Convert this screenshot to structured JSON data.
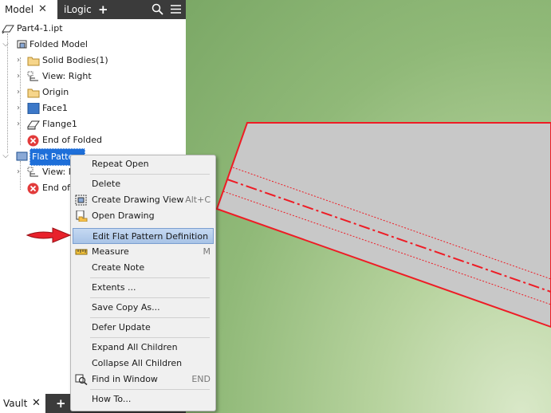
{
  "browser": {
    "tabs": [
      {
        "label": "Model",
        "close": "✕"
      },
      {
        "label": "iLogic"
      }
    ],
    "add_tab": "+",
    "tree": {
      "root": "Part4-1.ipt",
      "folded_model": "Folded Model",
      "solid_bodies": "Solid Bodies(1)",
      "view_right": "View: Right",
      "origin": "Origin",
      "face1": "Face1",
      "flange1": "Flange1",
      "end_of_folded": "End of Folded",
      "flat_pattern": "Flat Pattern",
      "view_master": "View: Ma",
      "end_of_flat": "End of F"
    },
    "bottom_tabs": [
      {
        "label": "Vault",
        "close": "✕"
      }
    ],
    "bottom_add": "+"
  },
  "context_menu": {
    "items": [
      {
        "label": "Repeat Open",
        "shortcut": ""
      },
      {
        "label": "Delete",
        "shortcut": ""
      },
      {
        "label": "Create Drawing View",
        "shortcut": "Alt+C"
      },
      {
        "label": "Open Drawing",
        "shortcut": ""
      },
      {
        "label": "Edit Flat Pattern Definition",
        "shortcut": ""
      },
      {
        "label": "Measure",
        "shortcut": "M"
      },
      {
        "label": "Create Note",
        "shortcut": ""
      },
      {
        "label": "Extents ...",
        "shortcut": ""
      },
      {
        "label": "Save Copy As...",
        "shortcut": ""
      },
      {
        "label": "Defer Update",
        "shortcut": ""
      },
      {
        "label": "Expand All Children",
        "shortcut": ""
      },
      {
        "label": "Collapse All Children",
        "shortcut": ""
      },
      {
        "label": "Find in Window",
        "shortcut": "END"
      },
      {
        "label": "How To...",
        "shortcut": ""
      }
    ],
    "highlighted": "Edit Flat Pattern Definition"
  },
  "colors": {
    "accent_red": "#e8212b",
    "highlight": "#a8c3e6",
    "panel_dark": "#3b3b3b"
  },
  "icons": [
    "search-icon",
    "menu-icon",
    "part-icon",
    "folded-model-icon",
    "folder-icon",
    "view-icon",
    "face-icon",
    "flange-icon",
    "error-icon",
    "flat-pattern-icon",
    "drawing-view-icon",
    "open-drawing-icon",
    "measure-icon",
    "find-in-window-icon",
    "red-arrow"
  ]
}
